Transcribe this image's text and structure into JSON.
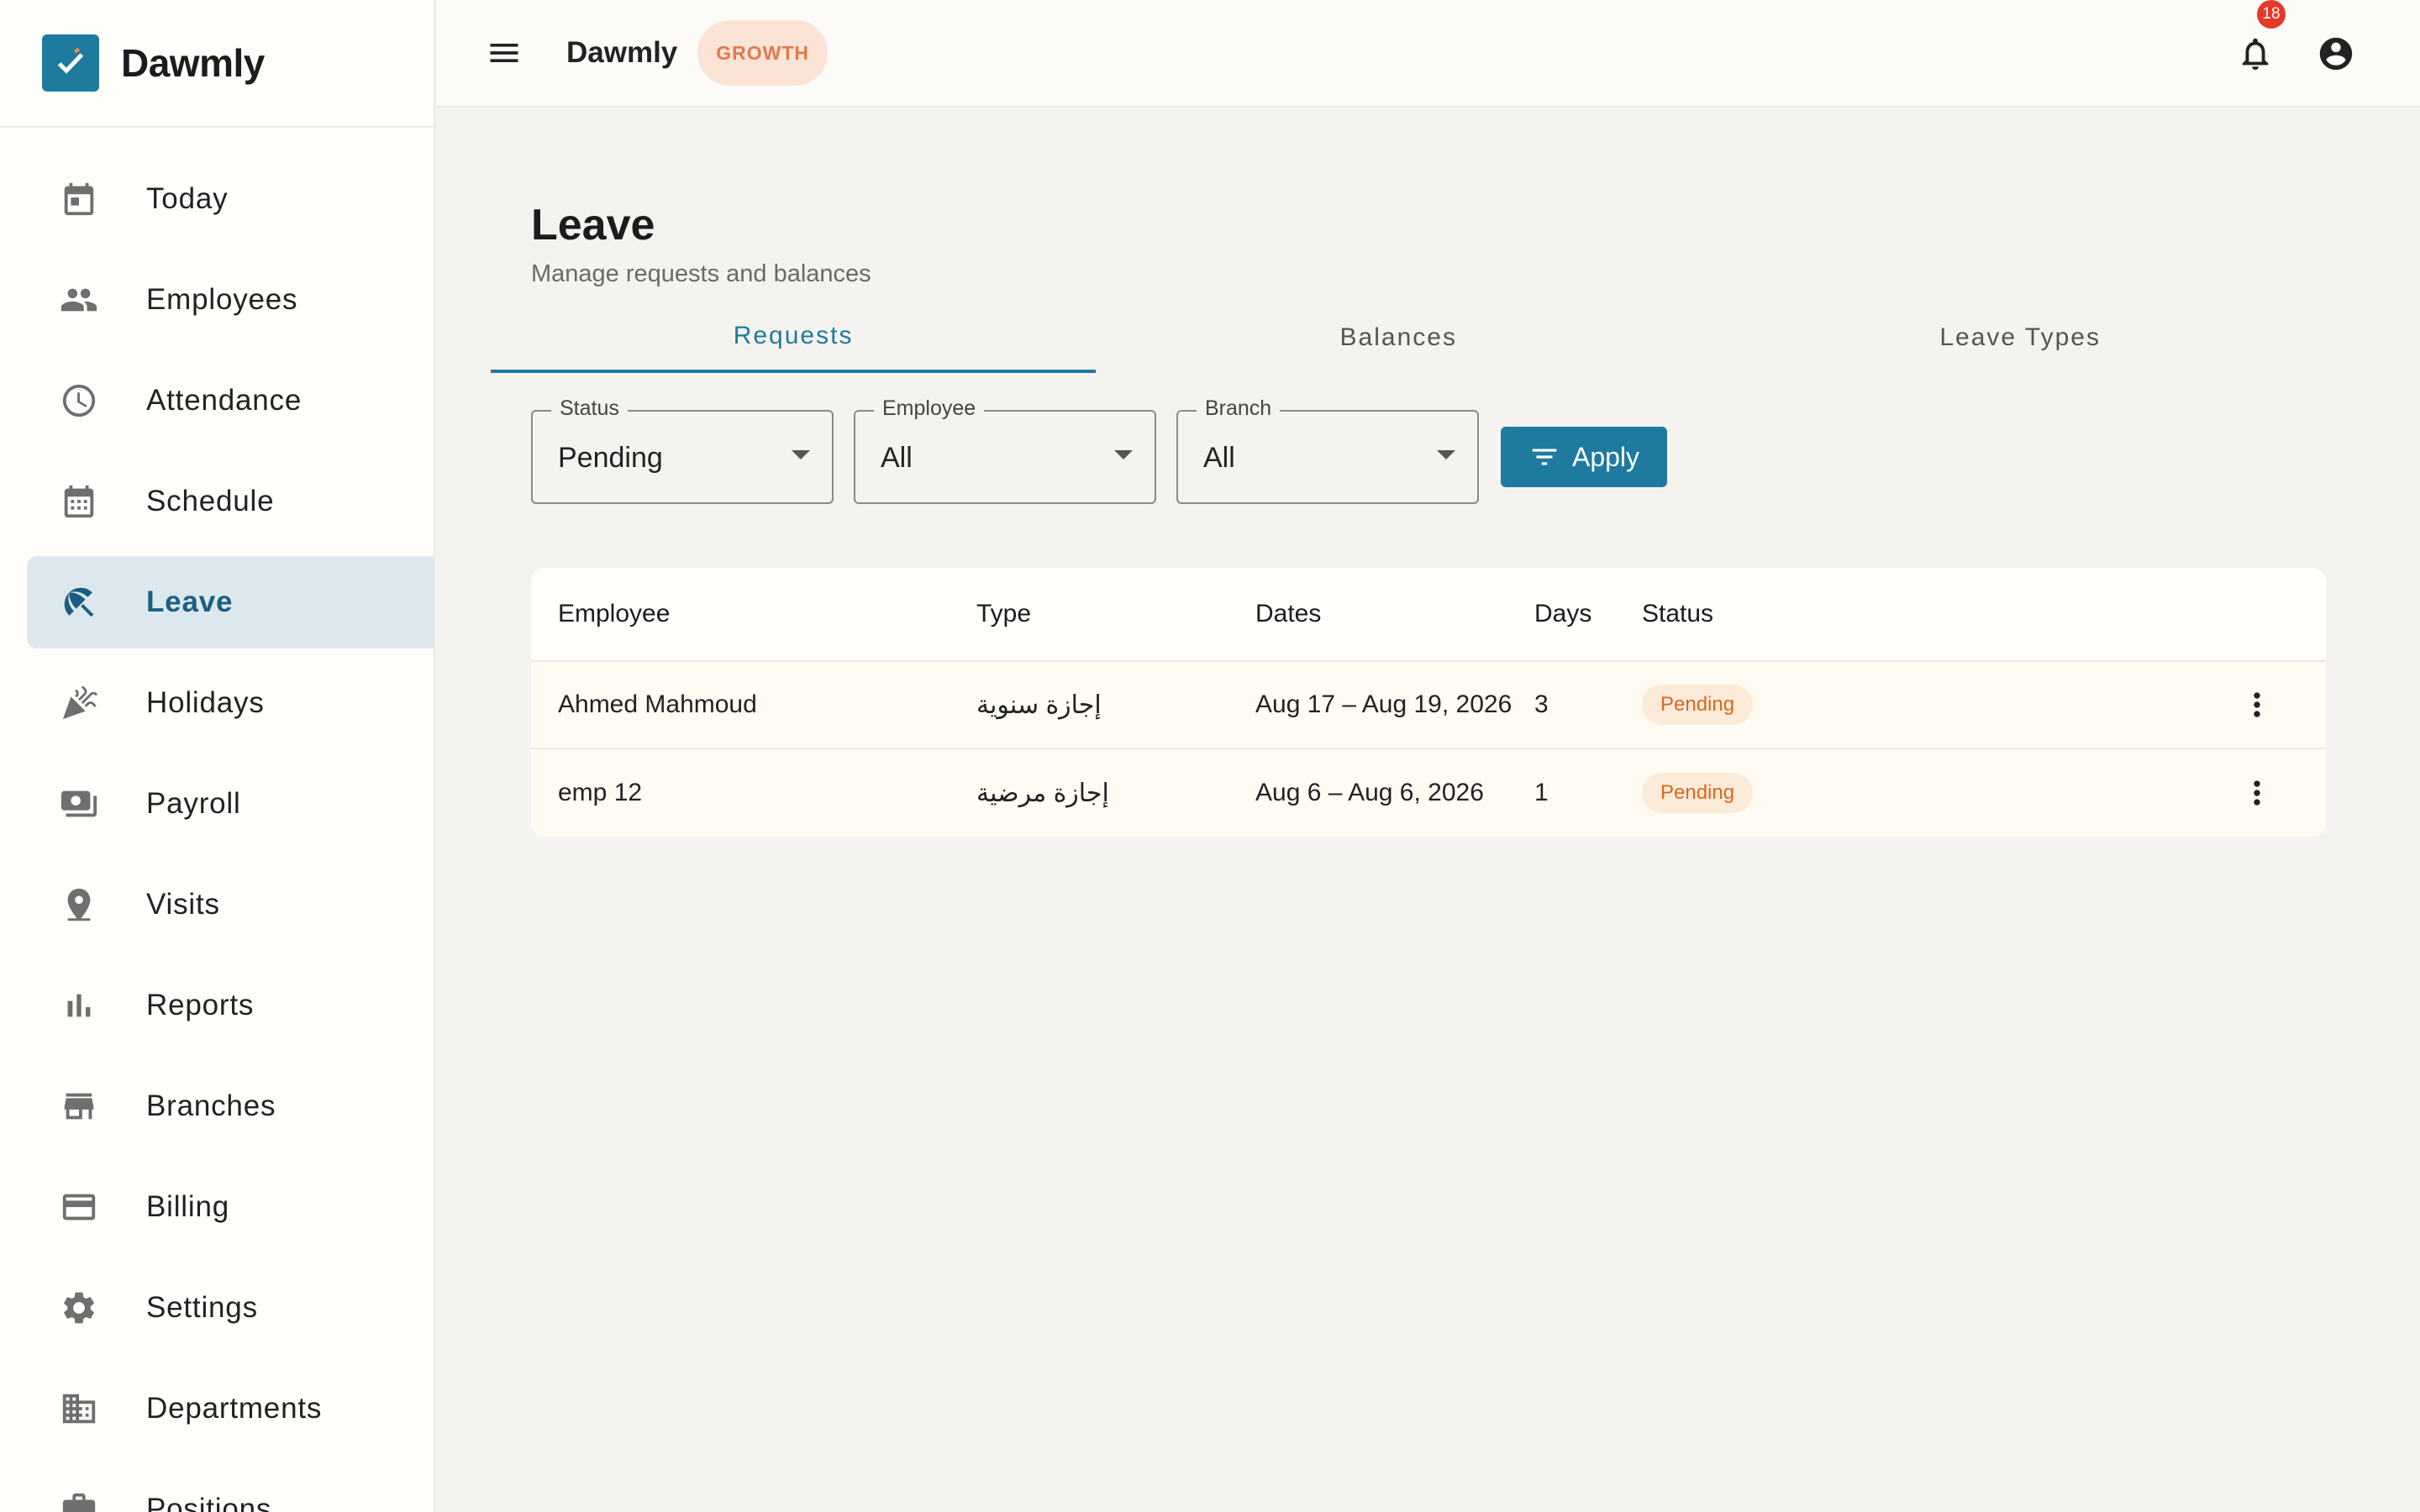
{
  "brand": {
    "name": "Dawmly",
    "accent": "#1f7aa0"
  },
  "sidebar": {
    "items": [
      {
        "label": "Today",
        "icon": "calendar-today-icon"
      },
      {
        "label": "Employees",
        "icon": "people-icon"
      },
      {
        "label": "Attendance",
        "icon": "clock-icon"
      },
      {
        "label": "Schedule",
        "icon": "calendar-grid-icon"
      },
      {
        "label": "Leave",
        "icon": "beach-umbrella-icon",
        "active": true
      },
      {
        "label": "Holidays",
        "icon": "celebration-icon"
      },
      {
        "label": "Payroll",
        "icon": "money-icon"
      },
      {
        "label": "Visits",
        "icon": "location-pin-icon"
      },
      {
        "label": "Reports",
        "icon": "bar-chart-icon"
      },
      {
        "label": "Branches",
        "icon": "store-icon"
      },
      {
        "label": "Billing",
        "icon": "credit-card-icon"
      },
      {
        "label": "Settings",
        "icon": "gear-icon"
      },
      {
        "label": "Departments",
        "icon": "building-icon"
      },
      {
        "label": "Positions",
        "icon": "briefcase-icon"
      }
    ]
  },
  "topbar": {
    "title": "Dawmly",
    "plan_badge": "GROWTH",
    "notification_count": "18"
  },
  "page": {
    "title": "Leave",
    "subtitle": "Manage requests and balances"
  },
  "tabs": [
    {
      "label": "Requests",
      "active": true
    },
    {
      "label": "Balances"
    },
    {
      "label": "Leave Types"
    }
  ],
  "filters": {
    "status": {
      "label": "Status",
      "value": "Pending"
    },
    "employee": {
      "label": "Employee",
      "value": "All"
    },
    "branch": {
      "label": "Branch",
      "value": "All"
    },
    "apply_label": "Apply"
  },
  "table": {
    "columns": [
      "Employee",
      "Type",
      "Dates",
      "Days",
      "Status"
    ],
    "rows": [
      {
        "employee": "Ahmed Mahmoud",
        "type": "إجازة سنوية",
        "dates": "Aug 17 – Aug 19, 2026",
        "days": "3",
        "status": "Pending"
      },
      {
        "employee": "emp 12",
        "type": "إجازة مرضية",
        "dates": "Aug 6 – Aug 6, 2026",
        "days": "1",
        "status": "Pending"
      }
    ]
  }
}
